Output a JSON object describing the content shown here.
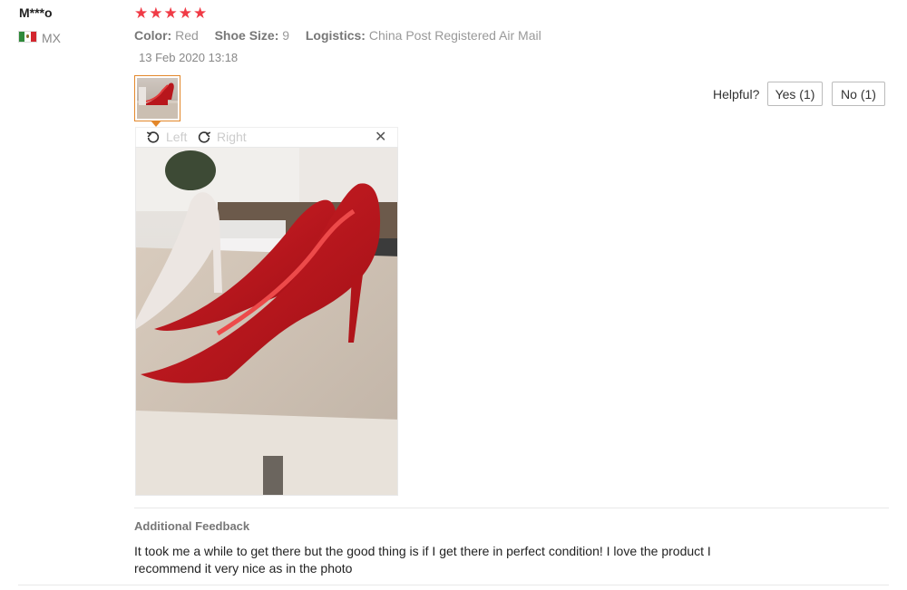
{
  "reviewer": {
    "name": "M***o",
    "country": "MX",
    "flag_icon": "mexico-flag-icon"
  },
  "rating": {
    "stars": 5,
    "max": 5,
    "star_glyphs": "★★★★★",
    "color": "#f03b46"
  },
  "attributes": {
    "color_label": "Color:",
    "color_value": "Red",
    "size_label": "Shoe Size:",
    "size_value": "9",
    "logistics_label": "Logistics:",
    "logistics_value": "China Post Registered Air Mail"
  },
  "date": "13 Feb 2020 13:18",
  "helpful": {
    "label": "Helpful?",
    "yes_label": "Yes (1)",
    "no_label": "No (1)"
  },
  "viewer": {
    "rotate_left_label": "Left",
    "rotate_right_label": "Right",
    "close_glyph": "✕"
  },
  "additional_feedback": {
    "title": "Additional Feedback",
    "text": "It took me a while to get there but the good thing is if I get there in perfect condition! I love the product I recommend it very nice as in the photo"
  },
  "colors": {
    "accent": "#e3872a",
    "star": "#f03b46"
  }
}
